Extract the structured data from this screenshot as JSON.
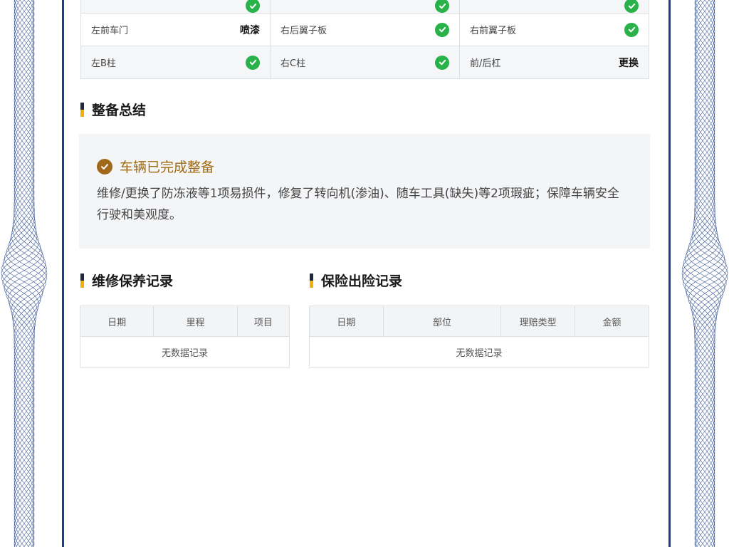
{
  "damage_grid": {
    "rows": [
      [
        {
          "label": "",
          "status": "check"
        },
        {
          "label": "",
          "status": "check"
        },
        {
          "label": "",
          "status": "check"
        }
      ],
      [
        {
          "label": "左前车门",
          "status": "text",
          "text": "喷漆"
        },
        {
          "label": "右后翼子板",
          "status": "check"
        },
        {
          "label": "右前翼子板",
          "status": "check"
        }
      ],
      [
        {
          "label": "左B柱",
          "status": "check"
        },
        {
          "label": "右C柱",
          "status": "check"
        },
        {
          "label": "前/后杠",
          "status": "text",
          "text": "更换"
        }
      ]
    ]
  },
  "summary": {
    "section_title": "整备总结",
    "status": "车辆已完成整备",
    "description": "维修/更换了防冻液等1项易损件，修复了转向机(渗油)、随车工具(缺失)等2项瑕疵；保障车辆安全行驶和美观度。"
  },
  "maintenance": {
    "section_title": "维修保养记录",
    "columns": [
      "日期",
      "里程",
      "项目"
    ],
    "empty_text": "无数据记录"
  },
  "insurance": {
    "section_title": "保险出险记录",
    "columns": [
      "日期",
      "部位",
      "理赔类型",
      "金额"
    ],
    "empty_text": "无数据记录"
  },
  "colors": {
    "frame": "#1d3f86",
    "check_green": "#29b24a",
    "gold": "#a06a10",
    "accent_yellow": "#f0b100"
  }
}
